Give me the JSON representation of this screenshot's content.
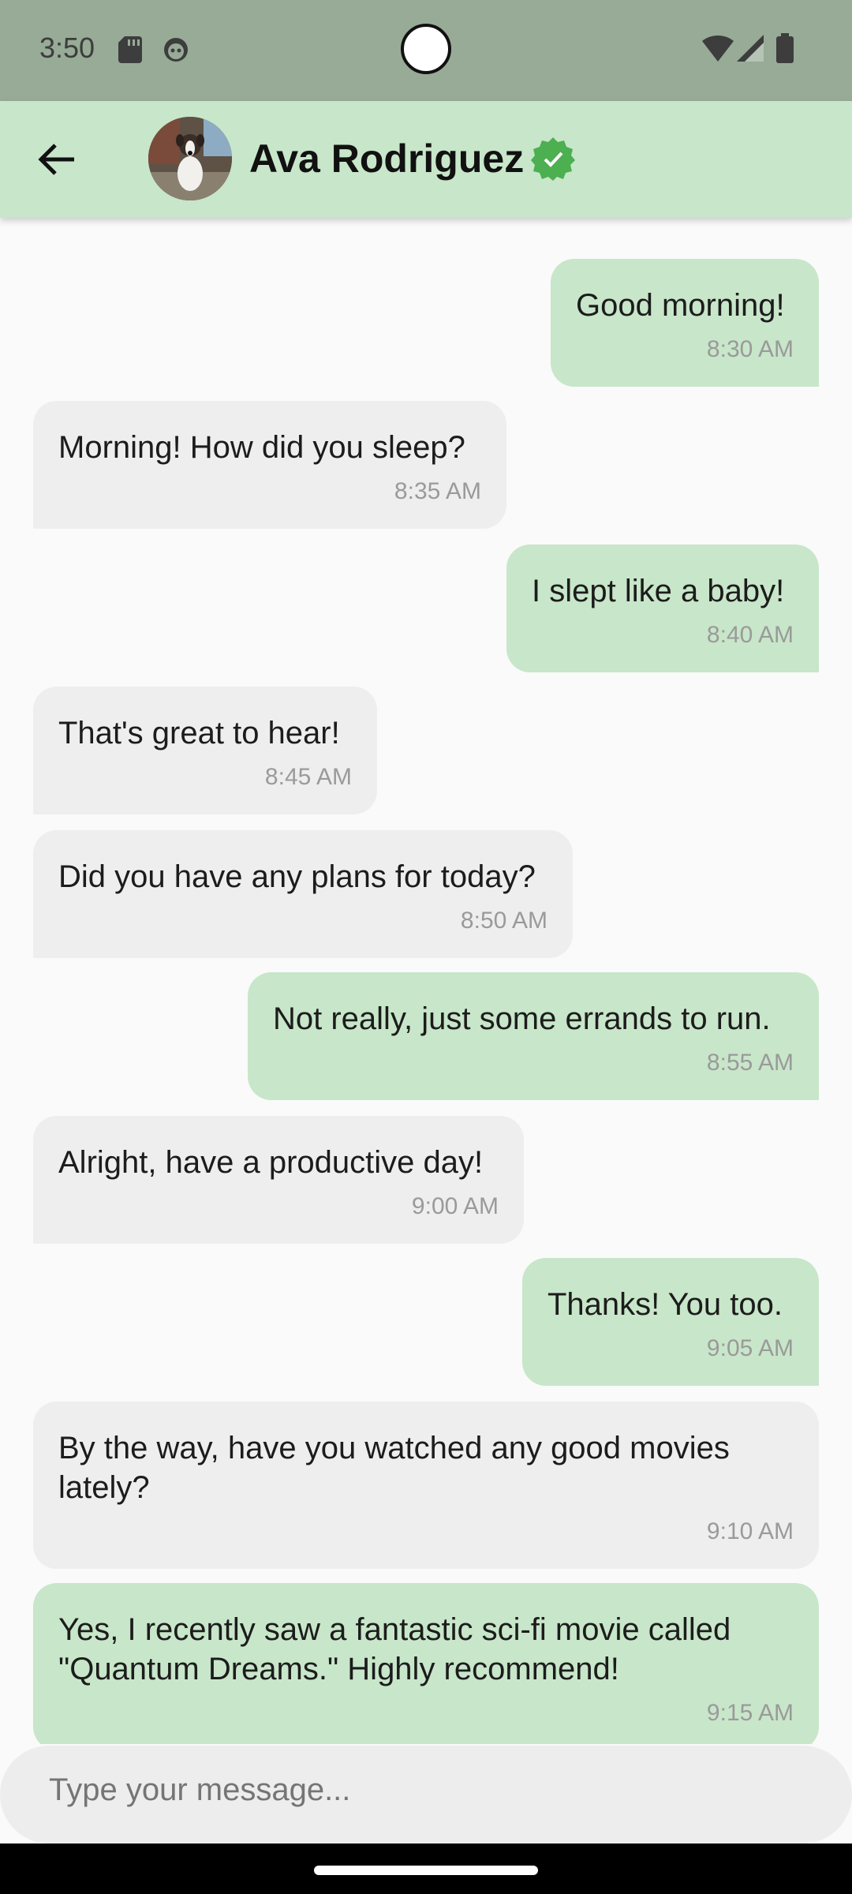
{
  "status_bar": {
    "time": "3:50",
    "icons": [
      "sd-card-icon",
      "notification-face-icon",
      "wifi-icon",
      "signal-icon",
      "battery-icon"
    ]
  },
  "header": {
    "back_icon": "arrow-back-icon",
    "contact_name": "Ava Rodriguez",
    "verified_icon": "verified-badge-icon",
    "accent_color": "#4caf50",
    "bar_color": "#c8e6c9"
  },
  "messages": [
    {
      "direction": "out",
      "text": "Good morning!",
      "time": "8:30 AM"
    },
    {
      "direction": "in",
      "text": "Morning! How did you sleep?",
      "time": "8:35 AM"
    },
    {
      "direction": "out",
      "text": "I slept like a baby!",
      "time": "8:40 AM"
    },
    {
      "direction": "in",
      "text": "That's great to hear!",
      "time": "8:45 AM"
    },
    {
      "direction": "in",
      "text": "Did you have any plans for today?",
      "time": "8:50 AM"
    },
    {
      "direction": "out",
      "text": "Not really, just some errands to run.",
      "time": "8:55 AM"
    },
    {
      "direction": "in",
      "text": "Alright, have a productive day!",
      "time": "9:00 AM"
    },
    {
      "direction": "out",
      "text": "Thanks! You too.",
      "time": "9:05 AM"
    },
    {
      "direction": "in",
      "text": "By the way, have you watched any good movies lately?",
      "time": "9:10 AM"
    },
    {
      "direction": "out",
      "text": "Yes, I recently saw a fantastic sci-fi movie called \"Quantum Dreams.\" Highly recommend!",
      "time": "9:15 AM"
    }
  ],
  "composer": {
    "placeholder": "Type your message..."
  }
}
